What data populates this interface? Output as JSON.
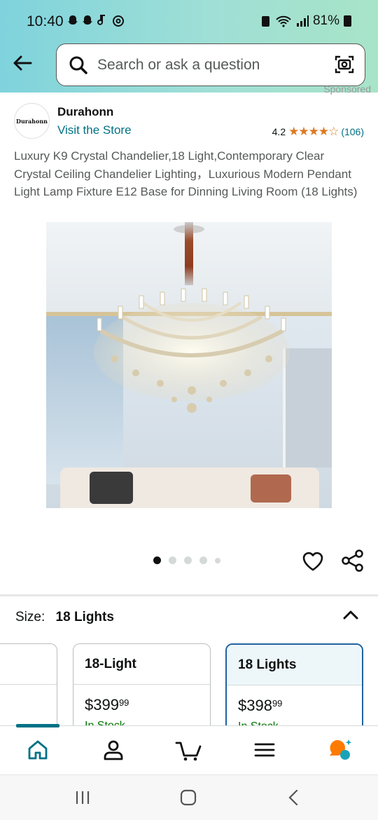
{
  "status_bar": {
    "time": "10:40",
    "left_icons": "♟♟♪@",
    "battery": "81%"
  },
  "search": {
    "placeholder": "Search or ask a question"
  },
  "sponsored": "Sponsored",
  "brand": {
    "logo_text": "Durahonn",
    "name": "Durahonn",
    "store_link": "Visit the Store"
  },
  "rating": {
    "value": "4.2",
    "stars": "★★★★☆",
    "count": "(106)"
  },
  "product_title": "Luxury K9 Crystal Chandelier,18 Light,Contemporary Clear Crystal Ceiling Chandelier Lighting，Luxurious Modern Pendant Light Lamp Fixture E12 Base for Dinning Living Room (18 Lights)",
  "carousel": {
    "total": 5,
    "active_index": 0
  },
  "size": {
    "label": "Size:",
    "value": "18 Lights"
  },
  "options": [
    {
      "name": "",
      "price_whole": "",
      "price_cents": "",
      "stock": ""
    },
    {
      "name": "18-Light",
      "price_whole": "$399",
      "price_cents": "99",
      "stock": "In Stock"
    },
    {
      "name": "18 Lights",
      "price_whole": "$398",
      "price_cents": "99",
      "stock": "In Stock"
    }
  ],
  "colors": {
    "link": "#007185",
    "stars": "#de7921",
    "selected_border": "#2162a1",
    "header_gradient_start": "#7fd3dc"
  },
  "nav_icons": [
    "home-icon",
    "account-icon",
    "cart-icon",
    "menu-icon",
    "rufus-icon"
  ]
}
